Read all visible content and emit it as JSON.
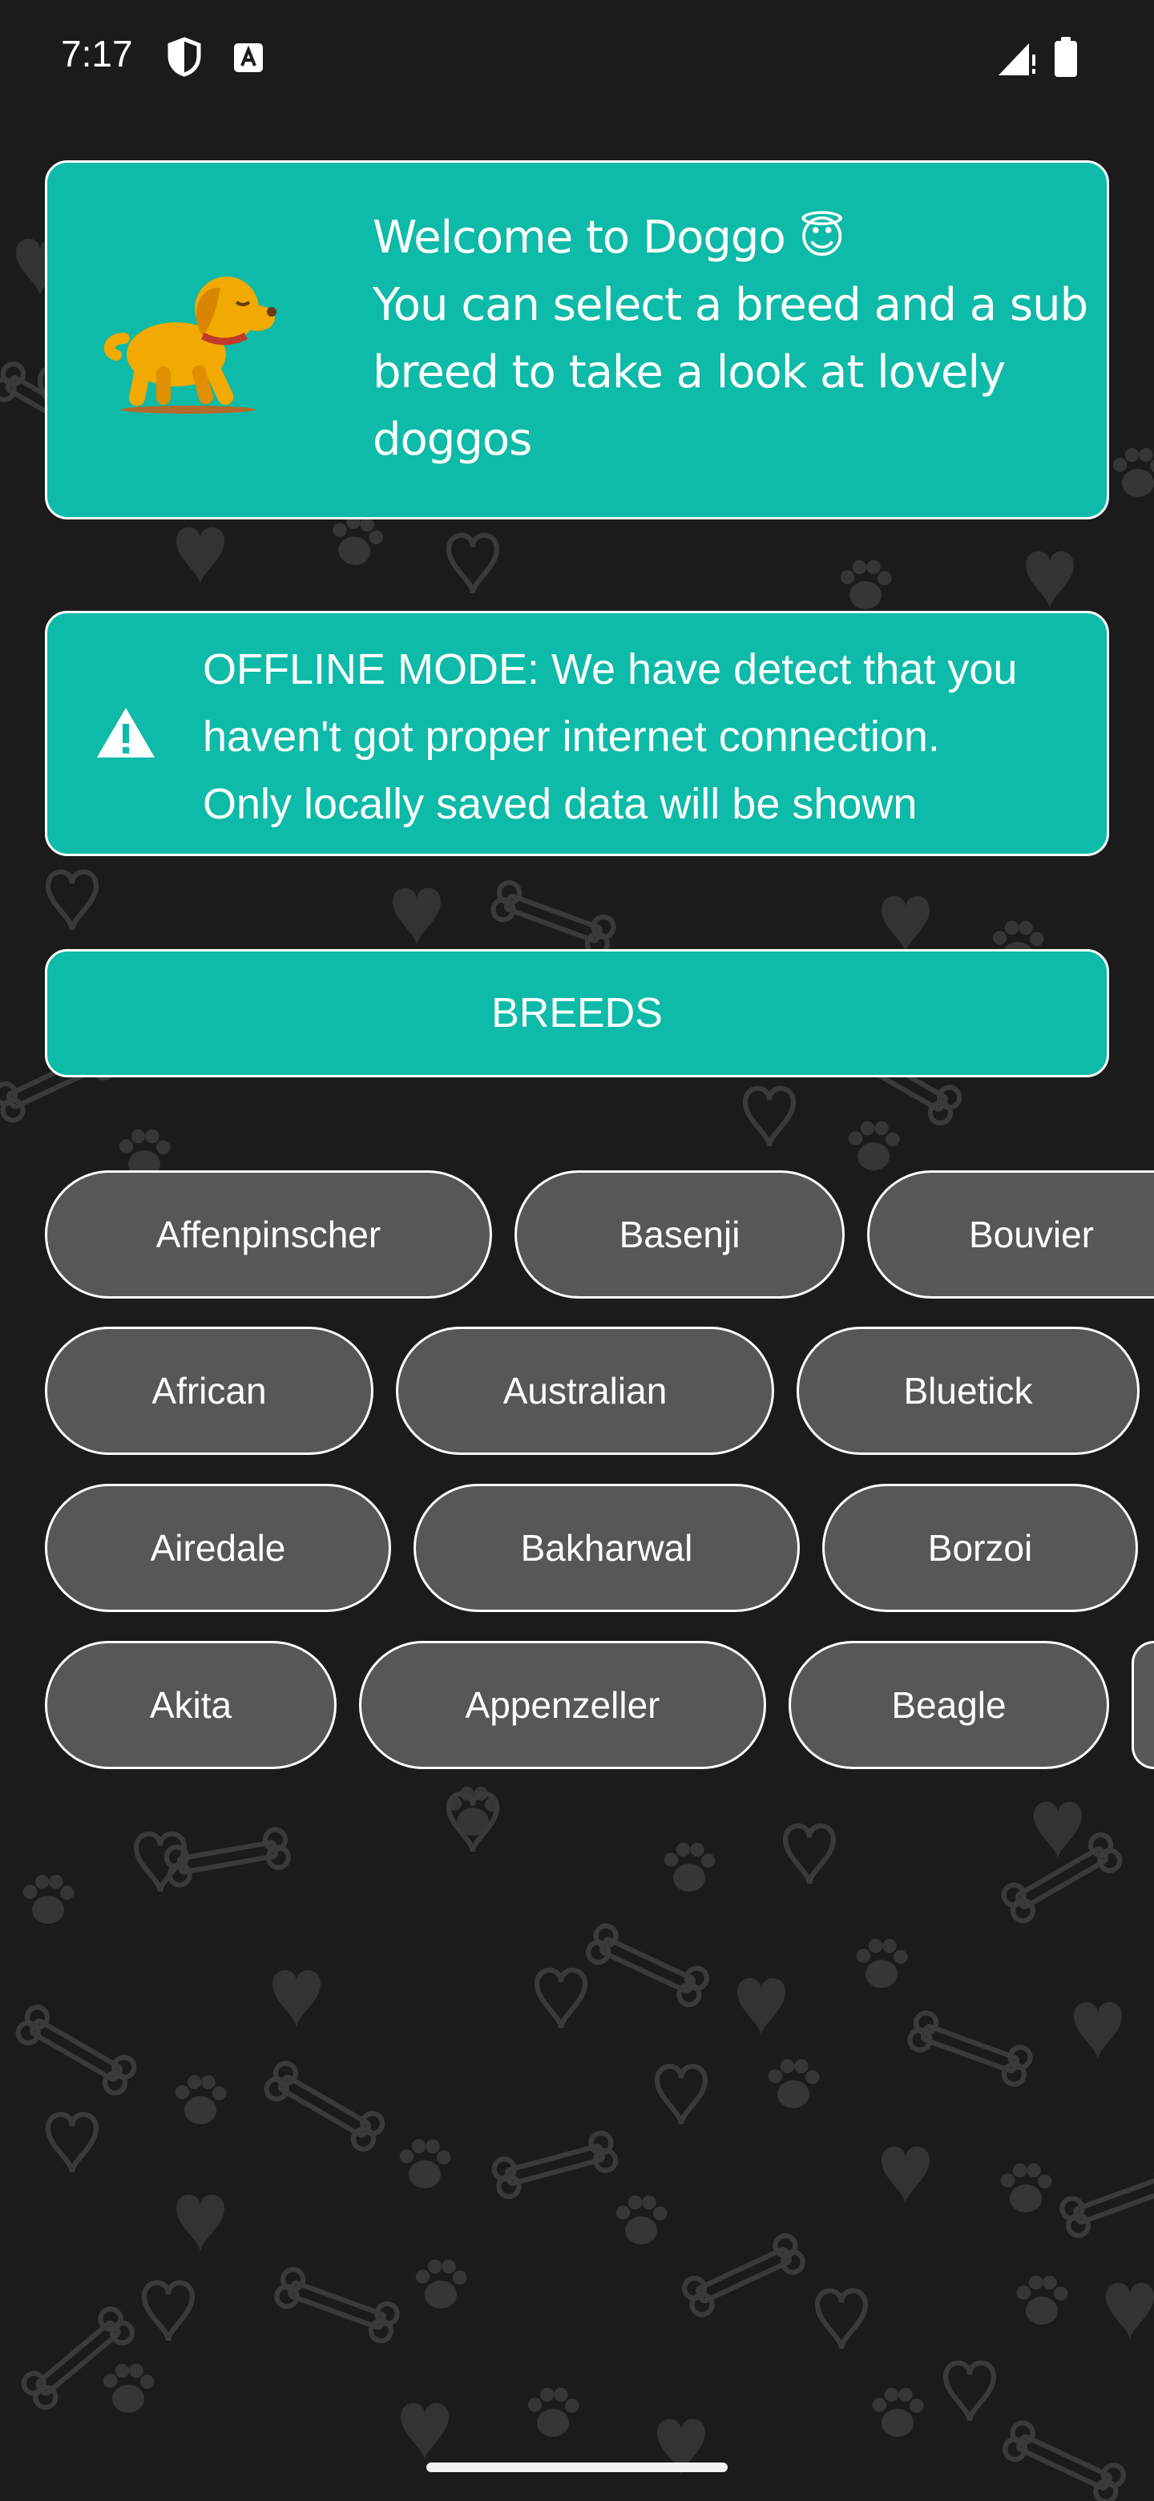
{
  "status_bar": {
    "time": "7:17",
    "icons": [
      "shield-icon",
      "font-icon",
      "signal-icon",
      "battery-icon"
    ]
  },
  "welcome_card": {
    "lines": [
      "Welcome to Doggo 😇",
      "You can select a breed and a sub",
      "breed to take a look at lovely",
      "doggos"
    ],
    "illustration": "dog-illustration"
  },
  "offline_card": {
    "icon": "warning-icon",
    "lines": [
      "OFFLINE MODE: We have detect that you",
      "haven't got proper internet connection.",
      "Only locally saved data will be shown"
    ]
  },
  "breeds_button": {
    "label": "BREEDS"
  },
  "breeds": {
    "row1": [
      "Affenpinscher",
      "Basenji",
      "Bouvier"
    ],
    "row2": [
      "African",
      "Australian",
      "Bluetick"
    ],
    "row3": [
      "Airedale",
      "Bakharwal",
      "Borzoi"
    ],
    "row4": [
      "Akita",
      "Appenzeller",
      "Beagle",
      ""
    ]
  },
  "colors": {
    "card": "#0ebaa8",
    "chip": "#575757",
    "background": "#1b1b1b",
    "pattern": "#3a3a3a"
  }
}
